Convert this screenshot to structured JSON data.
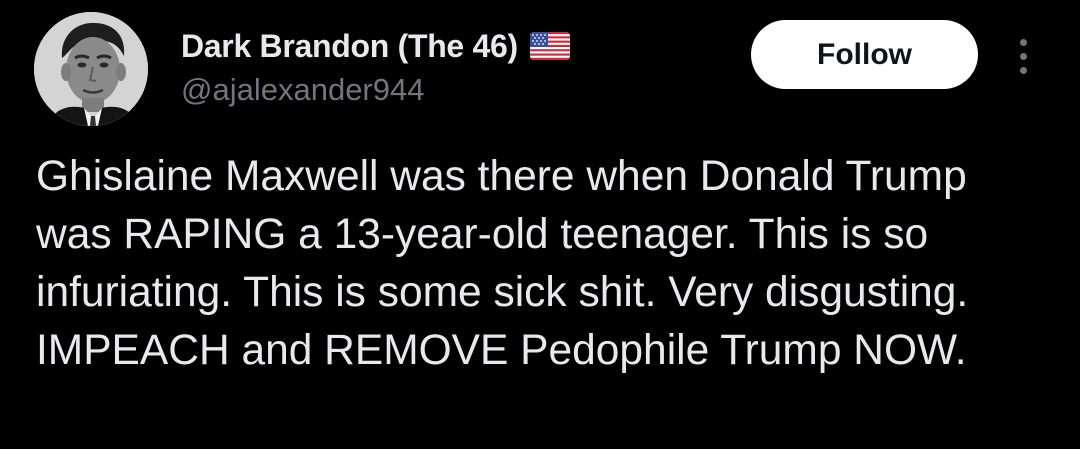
{
  "author": {
    "display_name": "Dark Brandon (The 46)",
    "handle": "@ajalexander944",
    "badge_icon": "us-flag-icon",
    "avatar_icon": "profile-avatar"
  },
  "actions": {
    "follow_label": "Follow",
    "more_icon": "more-vertical-icon"
  },
  "tweet": {
    "text": "Ghislaine Maxwell was there when Donald Trump was RAPING a 13-year-old teenager. This is so infuriating. This is some sick shit. Very disgusting. IMPEACH and REMOVE Pedophile Trump NOW."
  },
  "colors": {
    "background": "#000000",
    "primary_text": "#e7e9ea",
    "secondary_text": "#71767b",
    "follow_button_bg": "#ffffff",
    "follow_button_text": "#0f1419"
  }
}
